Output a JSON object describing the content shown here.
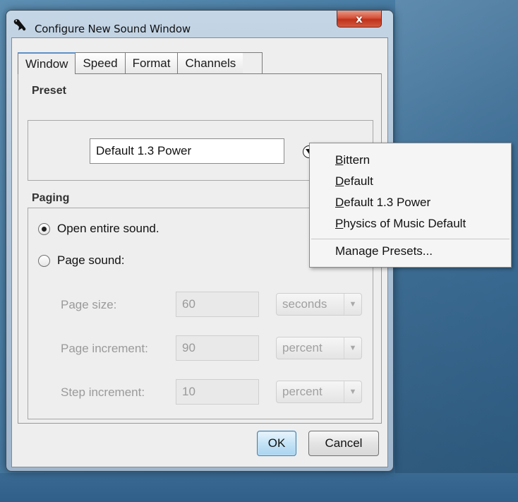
{
  "window": {
    "title": "Configure New Sound Window",
    "close_glyph": "x"
  },
  "tabs": [
    {
      "label": "Window",
      "active": true
    },
    {
      "label": "Speed",
      "active": false
    },
    {
      "label": "Format",
      "active": false
    },
    {
      "label": "Channels",
      "active": false
    }
  ],
  "preset": {
    "section_label": "Preset",
    "current_value": "Default 1.3 Power",
    "menu_icon": "chevron-down-circle-icon"
  },
  "paging": {
    "section_label": "Paging",
    "open_entire_label": "Open entire sound.",
    "open_entire_selected": true,
    "page_sound_label": "Page sound:",
    "page_sound_selected": false,
    "page_size": {
      "label": "Page size:",
      "value": "60",
      "unit": "seconds"
    },
    "page_increment": {
      "label": "Page increment:",
      "value": "90",
      "unit": "percent"
    },
    "step_increment": {
      "label": "Step increment:",
      "value": "10",
      "unit": "percent"
    }
  },
  "buttons": {
    "ok": "OK",
    "cancel": "Cancel"
  },
  "preset_menu": {
    "items": [
      {
        "mnemonic": "B",
        "rest": "ittern"
      },
      {
        "mnemonic": "D",
        "rest": "efault"
      },
      {
        "mnemonic": "D",
        "rest": "efault 1.3 Power"
      },
      {
        "mnemonic": "P",
        "rest": "hysics of Music Default"
      }
    ],
    "manage": "Manage Presets..."
  },
  "colors": {
    "desktop": "#4a7ea5",
    "close_button": "#c0321b",
    "default_button": "#a9d4f0",
    "active_tab_accent": "#5e90c8"
  }
}
